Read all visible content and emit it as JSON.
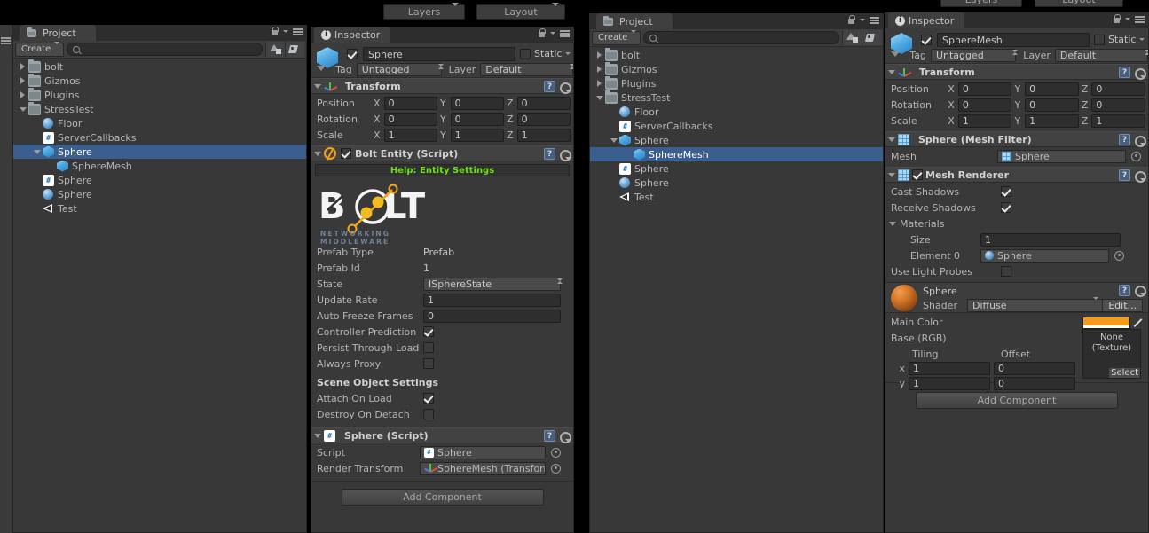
{
  "toolbar": {
    "layers_label": "Layers",
    "layout_label": "Layout"
  },
  "left": {
    "project": {
      "tab_label": "Project",
      "create_label": "Create",
      "search_placeholder": "",
      "icons": {
        "search": "search-icon",
        "lock": "lock-icon",
        "menu": "hamburger-menu-icon",
        "filter_type": "filter-by-type-icon",
        "filter_label": "filter-by-label-icon"
      },
      "tree": [
        {
          "label": "bolt",
          "icon": "folder-icon",
          "depth": 0,
          "twisty": "right",
          "selected": false
        },
        {
          "label": "Gizmos",
          "icon": "folder-icon",
          "depth": 0,
          "twisty": "right",
          "selected": false
        },
        {
          "label": "Plugins",
          "icon": "folder-icon",
          "depth": 0,
          "twisty": "right",
          "selected": false
        },
        {
          "label": "StressTest",
          "icon": "folder-icon",
          "depth": 0,
          "twisty": "down",
          "selected": false
        },
        {
          "label": "Floor",
          "icon": "sphere-icon",
          "depth": 1,
          "twisty": "none",
          "selected": false
        },
        {
          "label": "ServerCallbacks",
          "icon": "csharp-icon",
          "depth": 1,
          "twisty": "none",
          "selected": false
        },
        {
          "label": "Sphere",
          "icon": "prefab-icon",
          "depth": 1,
          "twisty": "down",
          "selected": true
        },
        {
          "label": "SphereMesh",
          "icon": "prefab-icon",
          "depth": 2,
          "twisty": "none",
          "selected": false
        },
        {
          "label": "Sphere",
          "icon": "csharp-icon",
          "depth": 1,
          "twisty": "none",
          "selected": false
        },
        {
          "label": "Sphere",
          "icon": "sphere-icon",
          "depth": 1,
          "twisty": "none",
          "selected": false
        },
        {
          "label": "Test",
          "icon": "scene-icon",
          "depth": 1,
          "twisty": "none",
          "selected": false
        }
      ]
    },
    "inspector": {
      "tab_label": "Inspector",
      "object_name": "Sphere",
      "enabled": true,
      "static_label": "Static",
      "static_checked": false,
      "tag_label": "Tag",
      "tag_value": "Untagged",
      "layer_label": "Layer",
      "layer_value": "Default",
      "transform": {
        "title": "Transform",
        "rows": [
          {
            "label": "Position",
            "x": "0",
            "y": "0",
            "z": "0"
          },
          {
            "label": "Rotation",
            "x": "0",
            "y": "0",
            "z": "0"
          },
          {
            "label": "Scale",
            "x": "1",
            "y": "1",
            "z": "1"
          }
        ],
        "axis_labels": [
          "X",
          "Y",
          "Z"
        ]
      },
      "bolt_entity": {
        "title": "Bolt Entity (Script)",
        "enabled": true,
        "help_label": "Help: Entity Settings",
        "help_color": "#6fdf17",
        "logo_text": "BOLT",
        "logo_tagline": "NETWORKING MIDDLEWARE",
        "fields": [
          {
            "label": "Prefab Type",
            "value": "Prefab",
            "kind": "text"
          },
          {
            "label": "Prefab Id",
            "value": "1",
            "kind": "text"
          },
          {
            "label": "State",
            "value": "ISphereState",
            "kind": "popup"
          },
          {
            "label": "Update Rate",
            "value": "1",
            "kind": "input"
          },
          {
            "label": "Auto Freeze Frames",
            "value": "0",
            "kind": "input"
          },
          {
            "label": "Controller Prediction",
            "value": true,
            "kind": "check"
          },
          {
            "label": "Persist Through Load",
            "value": false,
            "kind": "check"
          },
          {
            "label": "Always Proxy",
            "value": false,
            "kind": "check"
          }
        ],
        "scene_settings_title": "Scene Object Settings",
        "scene_fields": [
          {
            "label": "Attach On Load",
            "value": true,
            "kind": "check"
          },
          {
            "label": "Destroy On Detach",
            "value": false,
            "kind": "check"
          }
        ]
      },
      "sphere_script": {
        "title": "Sphere (Script)",
        "rows": [
          {
            "label": "Script",
            "value": "Sphere",
            "icon": "csharp-icon"
          },
          {
            "label": "Render Transform",
            "value": "SphereMesh (Transform",
            "icon": "transform-icon"
          }
        ]
      },
      "add_component_label": "Add Component"
    }
  },
  "right": {
    "project": {
      "tab_label": "Project",
      "create_label": "Create",
      "search_placeholder": "",
      "tree": [
        {
          "label": "bolt",
          "icon": "folder-icon",
          "depth": 0,
          "twisty": "right",
          "selected": false
        },
        {
          "label": "Gizmos",
          "icon": "folder-icon",
          "depth": 0,
          "twisty": "right",
          "selected": false
        },
        {
          "label": "Plugins",
          "icon": "folder-icon",
          "depth": 0,
          "twisty": "right",
          "selected": false
        },
        {
          "label": "StressTest",
          "icon": "folder-icon",
          "depth": 0,
          "twisty": "down",
          "selected": false
        },
        {
          "label": "Floor",
          "icon": "sphere-icon",
          "depth": 1,
          "twisty": "none",
          "selected": false
        },
        {
          "label": "ServerCallbacks",
          "icon": "csharp-icon",
          "depth": 1,
          "twisty": "none",
          "selected": false
        },
        {
          "label": "Sphere",
          "icon": "prefab-icon",
          "depth": 1,
          "twisty": "down",
          "selected": false
        },
        {
          "label": "SphereMesh",
          "icon": "prefab-icon",
          "depth": 2,
          "twisty": "none",
          "selected": true
        },
        {
          "label": "Sphere",
          "icon": "csharp-icon",
          "depth": 1,
          "twisty": "none",
          "selected": false
        },
        {
          "label": "Sphere",
          "icon": "sphere-icon",
          "depth": 1,
          "twisty": "none",
          "selected": false
        },
        {
          "label": "Test",
          "icon": "scene-icon",
          "depth": 1,
          "twisty": "none",
          "selected": false
        }
      ]
    },
    "inspector": {
      "tab_label": "Inspector",
      "object_name": "SphereMesh",
      "enabled": true,
      "static_label": "Static",
      "static_checked": false,
      "tag_label": "Tag",
      "tag_value": "Untagged",
      "layer_label": "Layer",
      "layer_value": "Default",
      "transform": {
        "title": "Transform",
        "rows": [
          {
            "label": "Position",
            "x": "0",
            "y": "0",
            "z": "0"
          },
          {
            "label": "Rotation",
            "x": "0",
            "y": "0",
            "z": "0"
          },
          {
            "label": "Scale",
            "x": "1",
            "y": "1",
            "z": "1"
          }
        ],
        "axis_labels": [
          "X",
          "Y",
          "Z"
        ]
      },
      "mesh_filter": {
        "title": "Sphere (Mesh Filter)",
        "mesh_label": "Mesh",
        "mesh_value": "Sphere"
      },
      "mesh_renderer": {
        "title": "Mesh Renderer",
        "enabled": true,
        "cast_shadows_label": "Cast Shadows",
        "cast_shadows": true,
        "receive_shadows_label": "Receive Shadows",
        "receive_shadows": true,
        "materials_label": "Materials",
        "size_label": "Size",
        "size_value": "1",
        "element_label": "Element 0",
        "element_value": "Sphere",
        "light_probes_label": "Use Light Probes",
        "light_probes": false
      },
      "material": {
        "title": "Sphere",
        "shader_label": "Shader",
        "shader_value": "Diffuse",
        "edit_label": "Edit...",
        "main_color_label": "Main Color",
        "main_color_value": "#f49b1c",
        "base_label": "Base (RGB)",
        "tiling_label": "Tiling",
        "offset_label": "Offset",
        "rows": [
          {
            "axis": "x",
            "tiling": "1",
            "offset": "0"
          },
          {
            "axis": "y",
            "tiling": "1",
            "offset": "0"
          }
        ],
        "texture_none_line1": "None",
        "texture_none_line2": "(Texture)",
        "select_label": "Select"
      },
      "add_component_label": "Add Component"
    }
  }
}
